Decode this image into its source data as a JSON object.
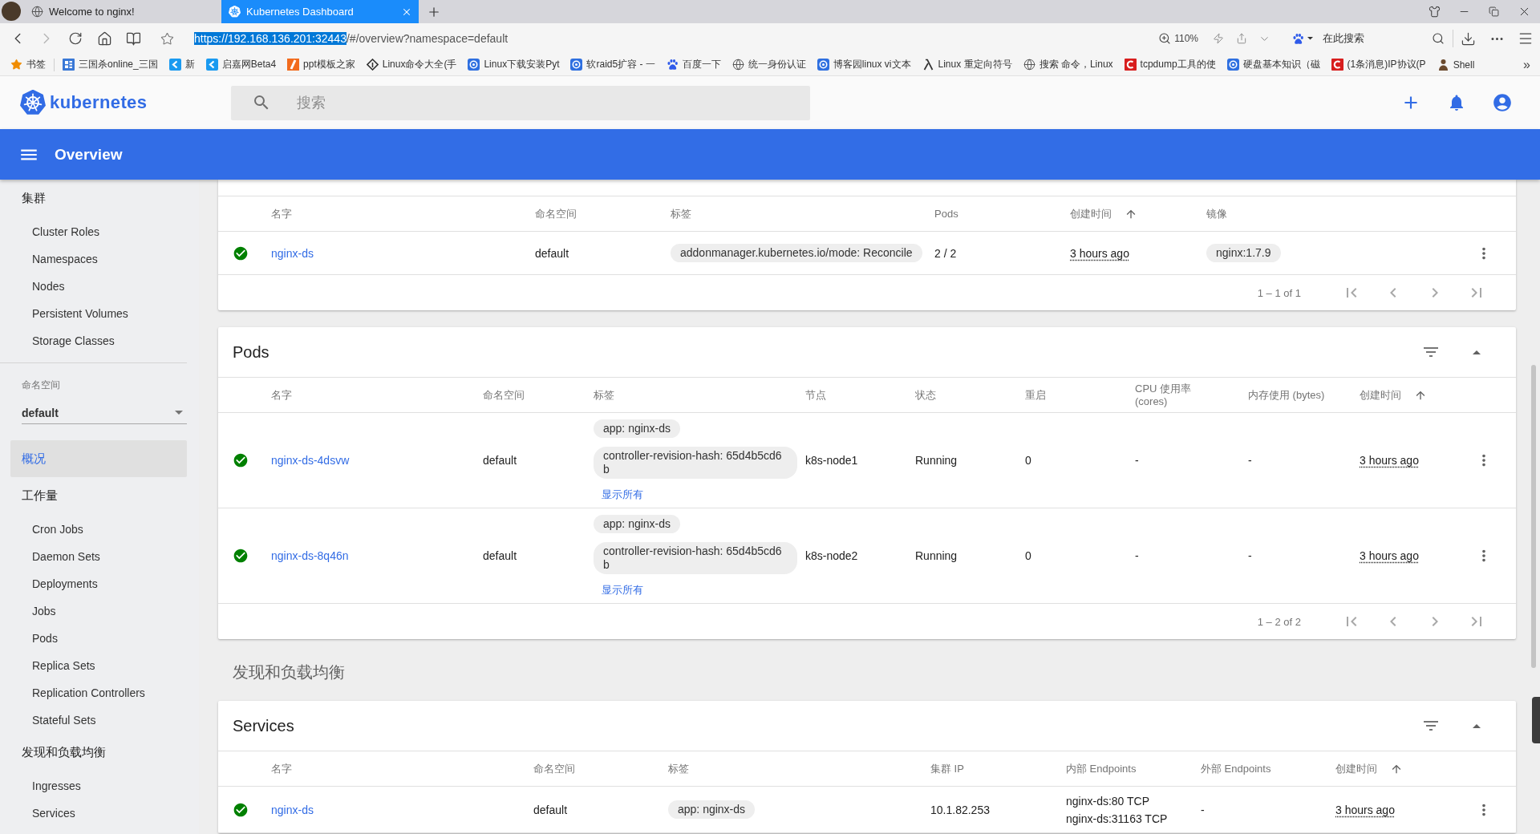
{
  "browser": {
    "tabs": [
      {
        "title": "Welcome to nginx!",
        "selected": false
      },
      {
        "title": "Kubernetes Dashboard",
        "selected": true
      }
    ],
    "address": {
      "highlighted": "https://192.168.136.201:32443",
      "rest": "/#/overview?namespace=default"
    },
    "zoom": "110%",
    "search_placeholder": "在此搜索",
    "bookmarks_folder": "书签",
    "bookmarks": [
      {
        "label": "三国杀online_三国"
      },
      {
        "label": "新"
      },
      {
        "label": "启嘉网Beta4"
      },
      {
        "label": "ppt模板之家"
      },
      {
        "label": "Linux命令大全(手"
      },
      {
        "label": "Linux下载安装Pyt"
      },
      {
        "label": "软raid5扩容 - 一"
      },
      {
        "label": "百度一下"
      },
      {
        "label": "统一身份认证"
      },
      {
        "label": "博客园linux vi文本"
      },
      {
        "label": "Linux 重定向符号"
      },
      {
        "label": "搜索 命令，Linux"
      },
      {
        "label": "tcpdump工具的使"
      },
      {
        "label": "硬盘基本知识（磁"
      },
      {
        "label": "(1条消息)IP协议(P"
      },
      {
        "label": "Shell"
      }
    ],
    "bookmarks_more": "»"
  },
  "app_header": {
    "logo": "kubernetes",
    "search_placeholder": "搜索"
  },
  "toolbar": {
    "title": "Overview"
  },
  "sidebar": {
    "menu_top": [
      {
        "label": "集群",
        "selected": false,
        "children": [
          {
            "label": "Cluster Roles",
            "selected": false
          },
          {
            "label": "Namespaces",
            "selected": false
          },
          {
            "label": "Nodes",
            "selected": false
          },
          {
            "label": "Persistent Volumes",
            "selected": false
          },
          {
            "label": "Storage Classes",
            "selected": false
          }
        ]
      }
    ],
    "namespace": {
      "label": "命名空间",
      "value": "default"
    },
    "menu": [
      {
        "label": "概况",
        "selected": true
      },
      {
        "label": "工作量",
        "selected": false,
        "children": [
          {
            "label": "Cron Jobs",
            "selected": false
          },
          {
            "label": "Daemon Sets",
            "selected": false
          },
          {
            "label": "Deployments",
            "selected": false
          },
          {
            "label": "Jobs",
            "selected": false
          },
          {
            "label": "Pods",
            "selected": false
          },
          {
            "label": "Replica Sets",
            "selected": false
          },
          {
            "label": "Replication Controllers",
            "selected": false
          },
          {
            "label": "Stateful Sets",
            "selected": false
          }
        ]
      },
      {
        "label": "发现和负载均衡",
        "selected": false,
        "children": [
          {
            "label": "Ingresses",
            "selected": false
          },
          {
            "label": "Services",
            "selected": false
          }
        ]
      }
    ]
  },
  "content": [
    {
      "kind": "card",
      "columns": [
        {
          "label": "名字",
          "kind": "link",
          "sorted": false
        },
        {
          "label": "命名空间",
          "kind": "text",
          "sorted": false
        },
        {
          "label": "标签",
          "kind": "chips",
          "sorted": false
        },
        {
          "label": "Pods",
          "kind": "text",
          "sorted": false
        },
        {
          "label": "创建时间",
          "kind": "time",
          "sorted": true
        },
        {
          "label": "镜像",
          "kind": "chips",
          "sorted": false
        }
      ],
      "rows": [
        {
          "healthy": true,
          "cells": [
            "nginx-ds",
            "default",
            {
              "chips": [
                "addonmanager.kubernetes.io/mode: Reconcile"
              ]
            },
            "2 / 2",
            "3 hours ago",
            {
              "chips": [
                "nginx:1.7.9"
              ]
            }
          ]
        }
      ],
      "paginator": {
        "range": "1 – 1 of 1",
        "disabled": true
      }
    },
    {
      "kind": "card",
      "title": "Pods",
      "expanded": true,
      "columns": [
        {
          "label": "名字",
          "kind": "link",
          "sorted": false
        },
        {
          "label": "命名空间",
          "kind": "text",
          "sorted": false
        },
        {
          "label": "标签",
          "kind": "chips",
          "sorted": false
        },
        {
          "label": "节点",
          "kind": "text",
          "sorted": false
        },
        {
          "label": "状态",
          "kind": "text",
          "sorted": false
        },
        {
          "label": "重启",
          "kind": "text",
          "sorted": false
        },
        {
          "label": "CPU 使用率 (cores)",
          "kind": "text",
          "sorted": false
        },
        {
          "label": "内存使用 (bytes)",
          "kind": "text",
          "sorted": false
        },
        {
          "label": "创建时间",
          "kind": "time",
          "sorted": true
        }
      ],
      "rows": [
        {
          "healthy": true,
          "cells": [
            "nginx-ds-4dsvw",
            "default",
            {
              "chips": [
                "app: nginx-ds",
                "controller-revision-hash: 65d4b5cd6b"
              ],
              "more": "显示所有"
            },
            "k8s-node1",
            "Running",
            "0",
            "-",
            "-",
            "3 hours ago"
          ]
        },
        {
          "healthy": true,
          "cells": [
            "nginx-ds-8q46n",
            "default",
            {
              "chips": [
                "app: nginx-ds",
                "controller-revision-hash: 65d4b5cd6b"
              ],
              "more": "显示所有"
            },
            "k8s-node2",
            "Running",
            "0",
            "-",
            "-",
            "3 hours ago"
          ]
        }
      ],
      "paginator": {
        "range": "1 – 2 of 2",
        "disabled": true
      }
    },
    {
      "kind": "heading",
      "text": "发现和负载均衡"
    },
    {
      "kind": "card",
      "title": "Services",
      "expanded": true,
      "columns": [
        {
          "label": "名字",
          "kind": "link",
          "sorted": false
        },
        {
          "label": "命名空间",
          "kind": "text",
          "sorted": false
        },
        {
          "label": "标签",
          "kind": "chips",
          "sorted": false
        },
        {
          "label": "集群 IP",
          "kind": "text",
          "sorted": false
        },
        {
          "label": "内部 Endpoints",
          "kind": "lines",
          "sorted": false
        },
        {
          "label": "外部 Endpoints",
          "kind": "text",
          "sorted": false
        },
        {
          "label": "创建时间",
          "kind": "time",
          "sorted": true
        }
      ],
      "rows": [
        {
          "healthy": true,
          "cells": [
            "nginx-ds",
            "default",
            {
              "chips": [
                "app: nginx-ds"
              ]
            },
            "10.1.82.253",
            [
              "nginx-ds:80 TCP",
              "nginx-ds:31163 TCP"
            ],
            "-",
            "3 hours ago"
          ]
        }
      ]
    }
  ]
}
